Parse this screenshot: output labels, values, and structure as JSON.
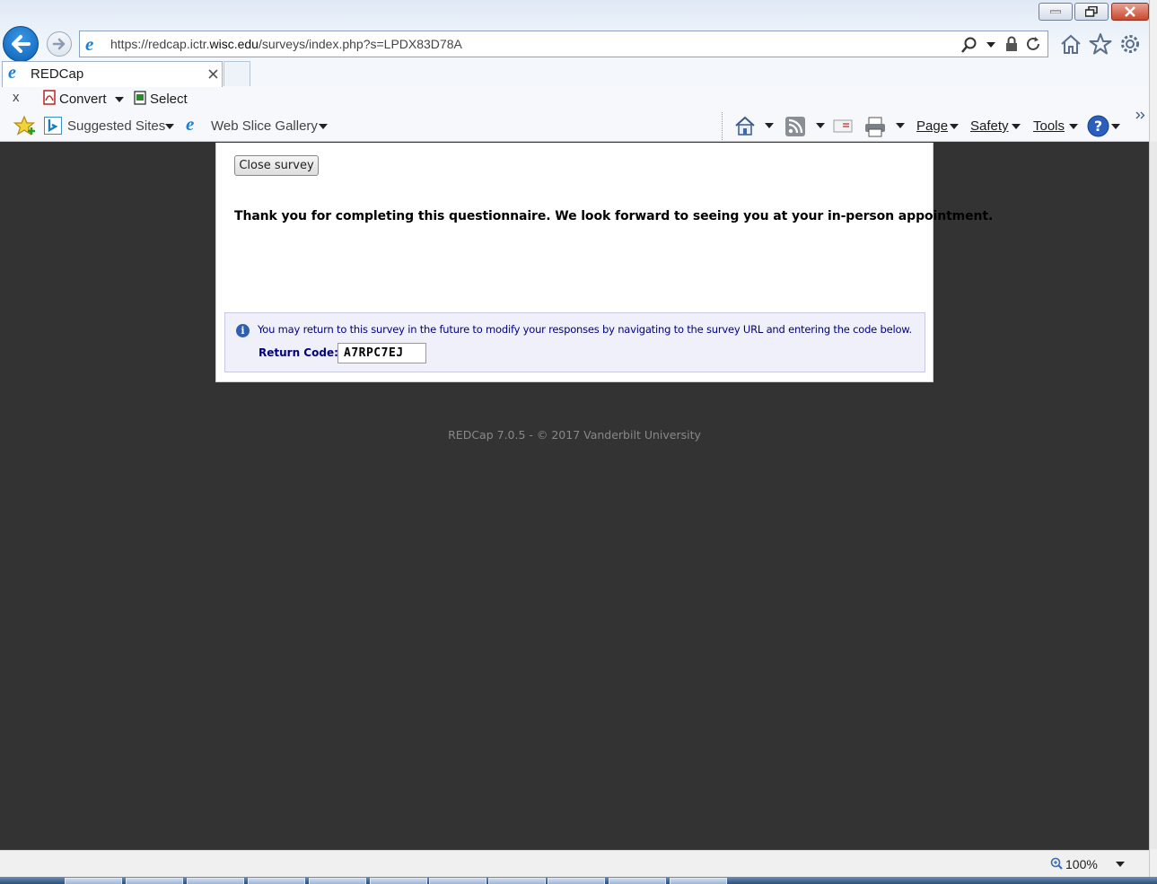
{
  "browser": {
    "address": {
      "url_prefix": "https://redcap.ictr.",
      "url_domain": "wisc.edu",
      "url_suffix": "/surveys/index.php?s=LPDX83D78A"
    },
    "tab": {
      "title": "REDCap"
    },
    "command_bar": {
      "convert_label": "Convert",
      "select_label": "Select",
      "close_label": "x"
    },
    "favorites_bar": {
      "suggested_sites": "Suggested Sites",
      "web_slice_gallery": "Web Slice Gallery"
    },
    "tools_bar": {
      "page": "Page",
      "safety": "Safety",
      "tools": "Tools"
    },
    "status": {
      "zoom": "100%"
    }
  },
  "survey": {
    "close_button": "Close survey",
    "thank_you": "Thank you for completing this questionnaire. We look forward to seeing you at your in-person appointment.",
    "return_info": "You may return to this survey in the future to modify your responses by navigating to the survey URL and entering the code below.",
    "return_code_label": "Return Code:",
    "return_code_value": "A7RPC7EJ"
  },
  "footer": {
    "text": "REDCap 7.0.5 - © 2017 Vanderbilt University"
  },
  "colors": {
    "page_background": "#333333",
    "info_text": "#000080",
    "return_box_background": "#f0f0fb"
  }
}
